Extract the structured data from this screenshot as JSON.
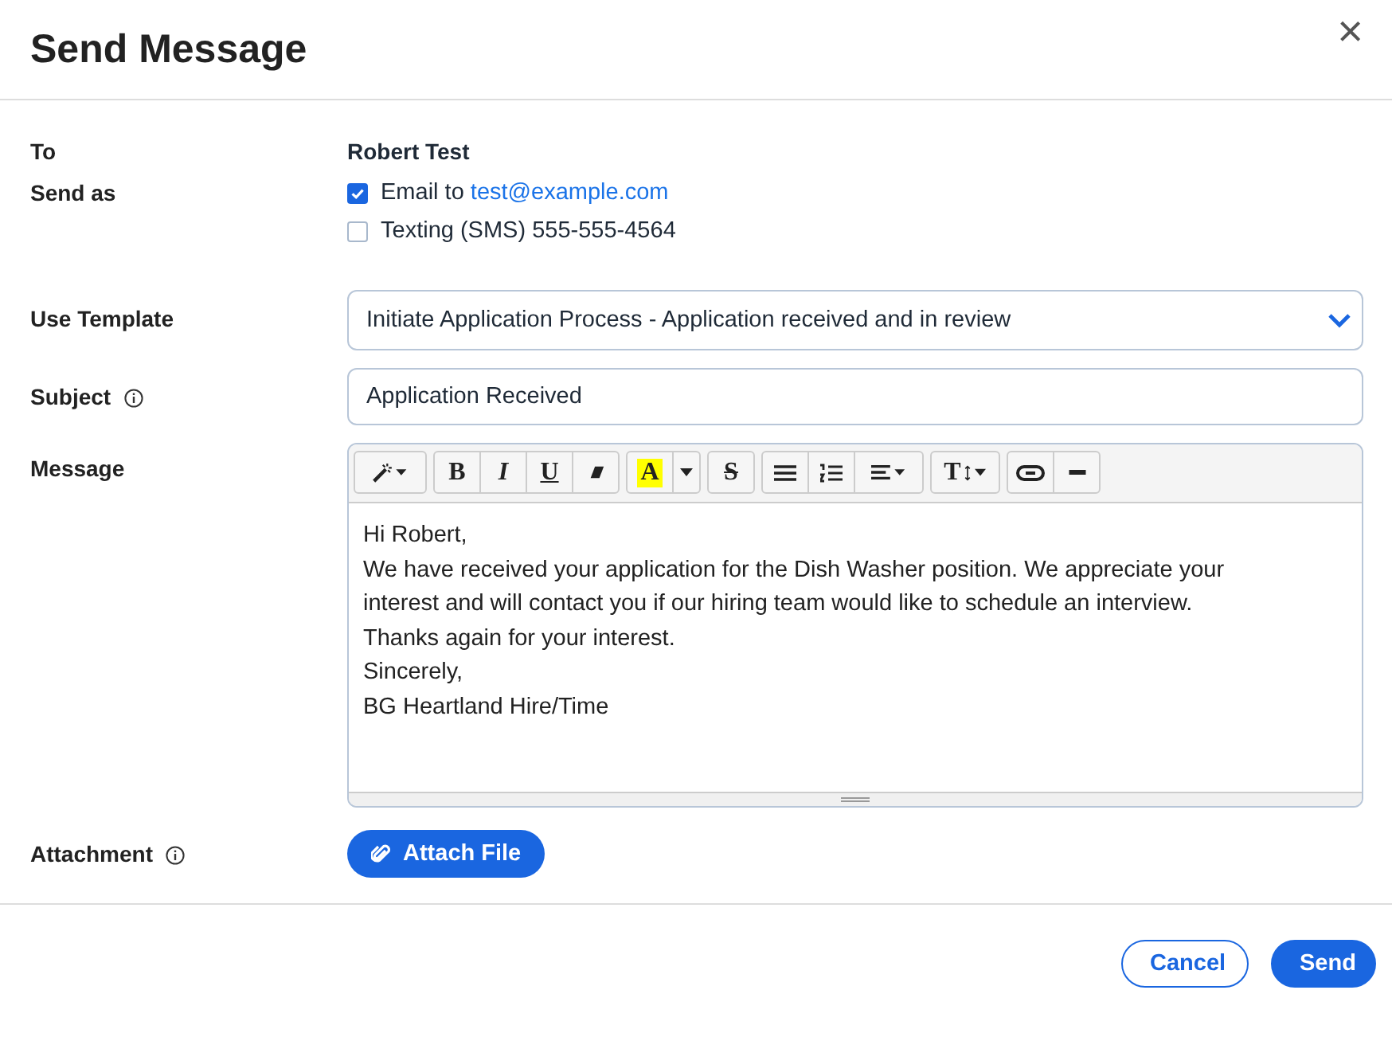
{
  "dialog": {
    "title": "Send Message",
    "close": "×"
  },
  "to": {
    "label": "To",
    "value": "Robert Test"
  },
  "send_as": {
    "label": "Send as",
    "options": [
      {
        "text": "Email to ",
        "link": "test@example.com",
        "checked": true
      },
      {
        "text": "Texting (SMS) 555-555-4564",
        "checked": false
      }
    ]
  },
  "template": {
    "label": "Use Template",
    "value": "Initiate Application Process - Application received and in review"
  },
  "subject": {
    "label": "Subject",
    "value": "Application Received"
  },
  "message": {
    "label": "Message",
    "toolbar": [
      [
        {
          "kind": "magic"
        }
      ],
      [
        {
          "kind": "glyph",
          "label": "B"
        },
        {
          "kind": "glyph",
          "label": "I"
        },
        {
          "kind": "glyph",
          "label": "U"
        },
        {
          "kind": "eraser"
        }
      ],
      [
        {
          "kind": "highlight",
          "label": "A"
        },
        {
          "kind": "caret"
        }
      ],
      [
        {
          "kind": "glyph",
          "label": "S"
        }
      ],
      [
        {
          "kind": "ul"
        },
        {
          "kind": "ol"
        },
        {
          "kind": "align"
        }
      ],
      [
        {
          "kind": "size",
          "label": "T"
        }
      ],
      [
        {
          "kind": "link"
        },
        {
          "kind": "hr"
        }
      ]
    ],
    "lines": [
      "Hi Robert,",
      "We have received your application for the Dish Washer position. We appreciate your interest and will contact you if our hiring team would like to schedule an interview.",
      "Thanks again for your interest.",
      "Sincerely,",
      "BG Heartland Hire/Time"
    ]
  },
  "attachment": {
    "label": "Attachment",
    "button": "Attach File"
  },
  "buttons": [
    {
      "label": "Cancel",
      "kind": "secondary"
    },
    {
      "label": "Send",
      "kind": "primary"
    }
  ]
}
